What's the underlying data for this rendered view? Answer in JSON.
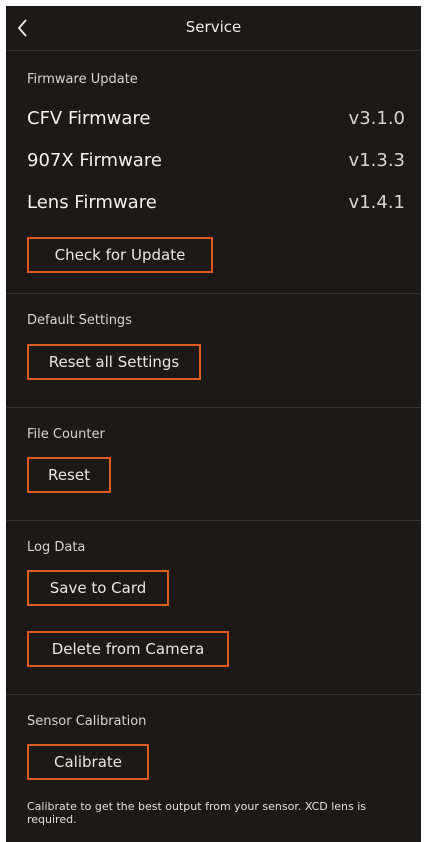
{
  "header": {
    "title": "Service"
  },
  "firmware": {
    "section_label": "Firmware Update",
    "items": [
      {
        "name": "CFV Firmware",
        "version": "v3.1.0"
      },
      {
        "name": "907X Firmware",
        "version": "v1.3.3"
      },
      {
        "name": "Lens Firmware",
        "version": "v1.4.1"
      }
    ],
    "button_label": "Check for Update"
  },
  "defaults": {
    "section_label": "Default Settings",
    "button_label": "Reset all Settings"
  },
  "file_counter": {
    "section_label": "File Counter",
    "button_label": "Reset"
  },
  "log_data": {
    "section_label": "Log Data",
    "save_label": "Save to Card",
    "delete_label": "Delete from Camera"
  },
  "sensor": {
    "section_label": "Sensor Calibration",
    "button_label": "Calibrate",
    "note": "Calibrate to get the best output from your sensor. XCD lens is required."
  },
  "colors": {
    "background": "#1d1916",
    "accent": "#e05a21"
  },
  "icons": {
    "back": "chevron-left-icon"
  }
}
